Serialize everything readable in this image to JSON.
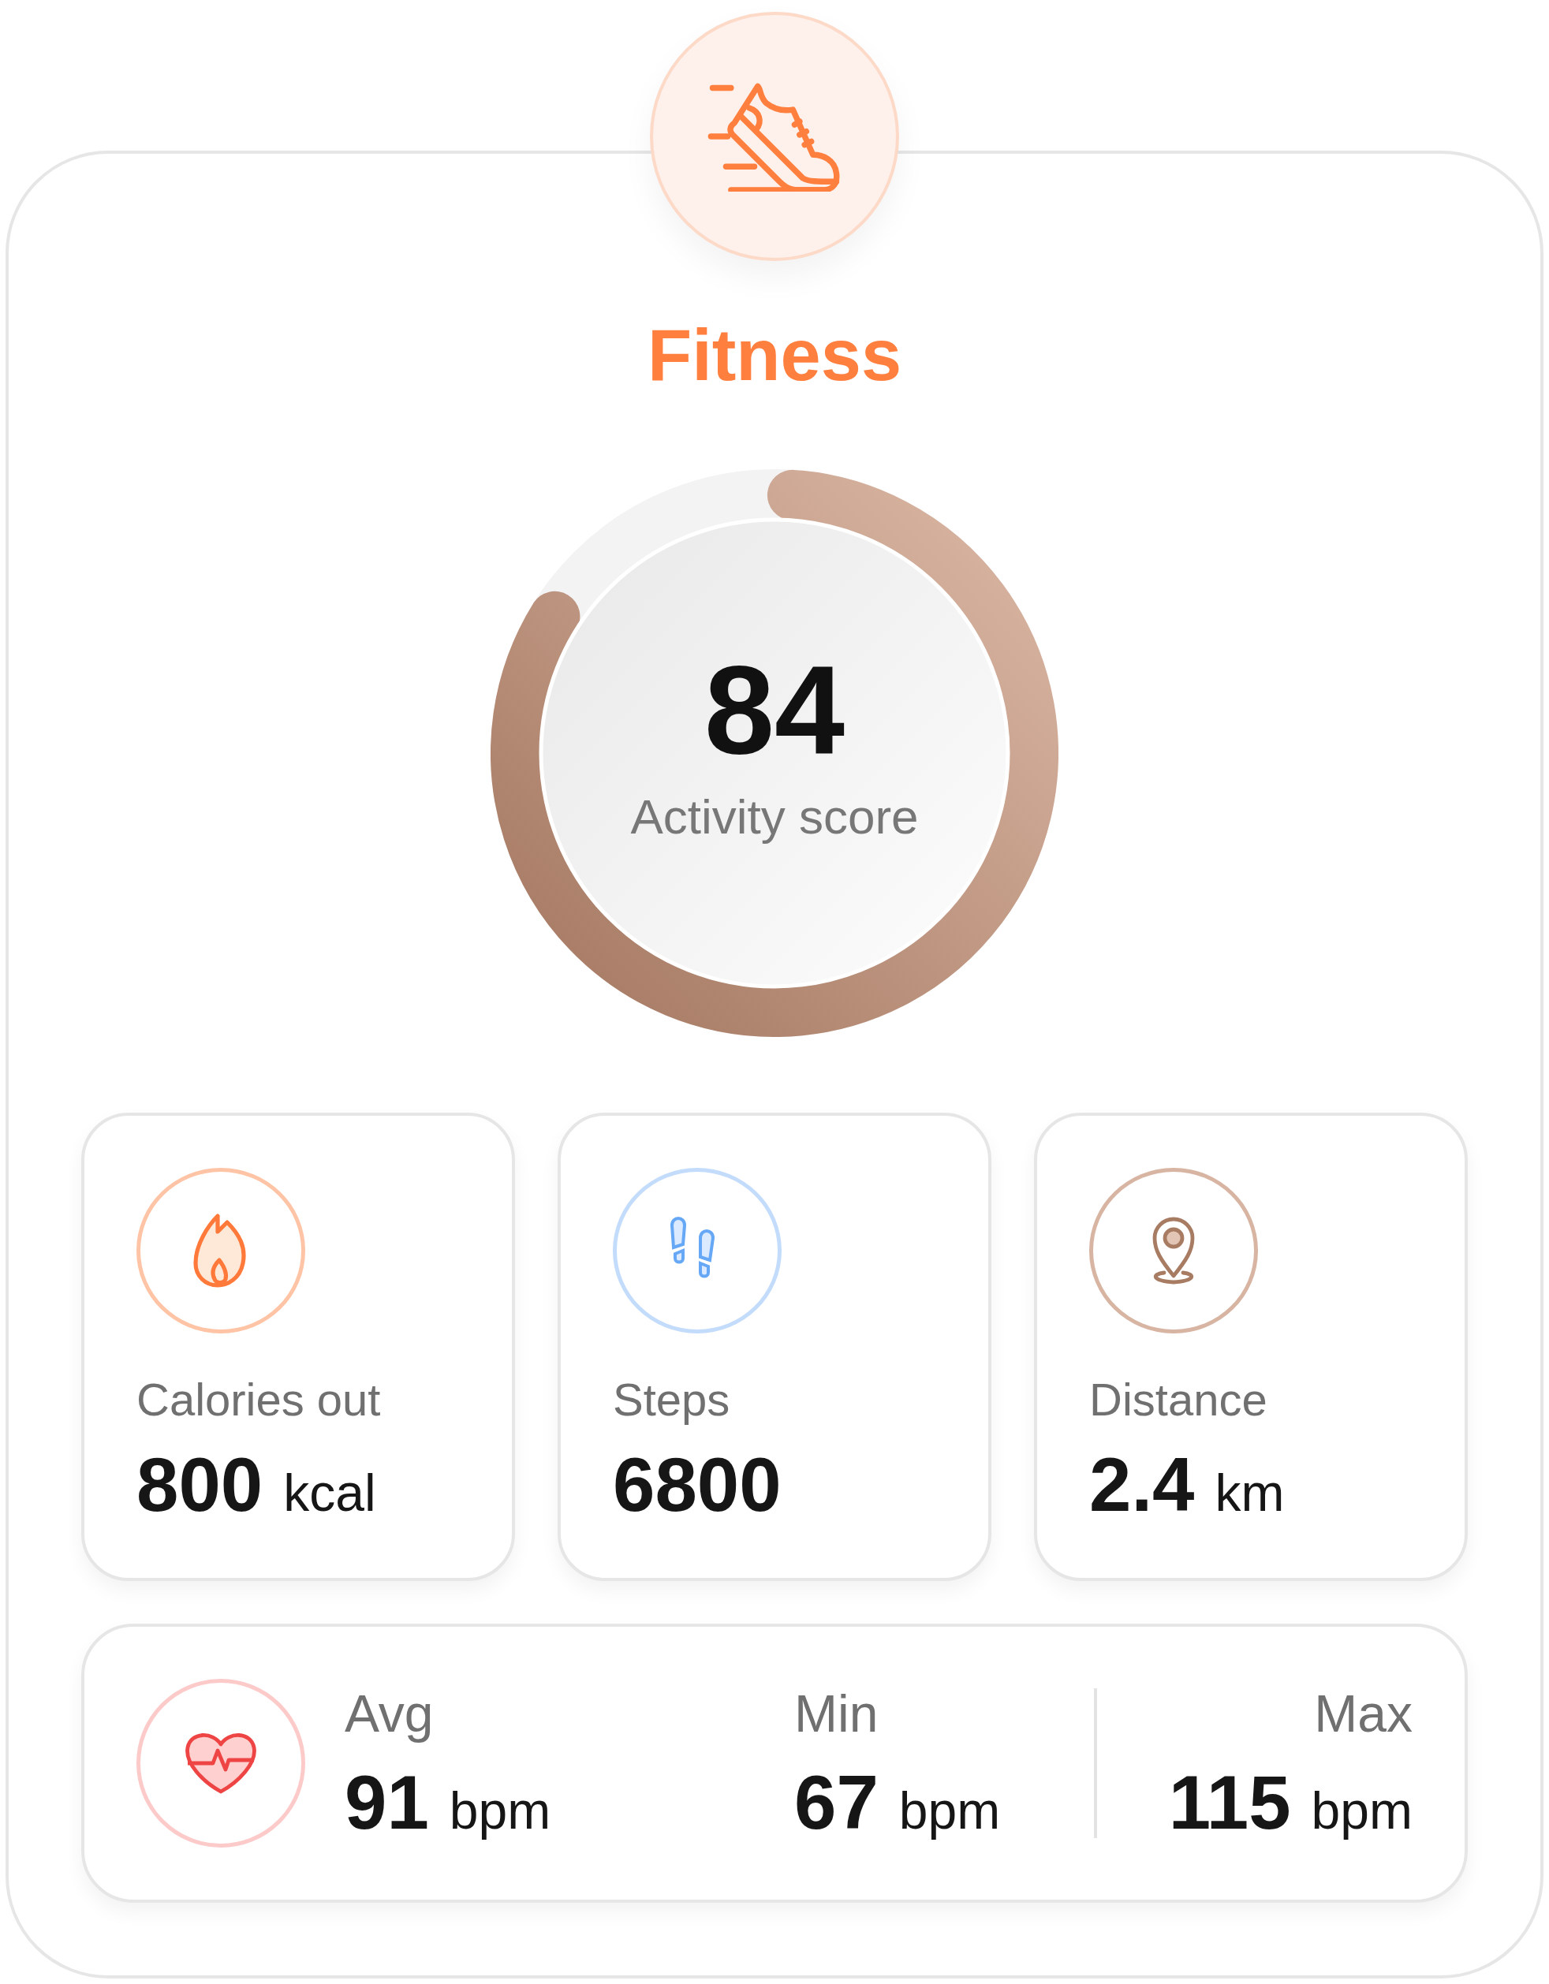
{
  "header": {
    "title": "Fitness"
  },
  "score": {
    "value": "84",
    "label": "Activity score"
  },
  "stats": [
    {
      "kind": "calories",
      "label": "Calories out",
      "value": "800",
      "unit": "kcal"
    },
    {
      "kind": "steps",
      "label": "Steps",
      "value": "6800"
    },
    {
      "kind": "distance",
      "label": "Distance",
      "value": "2.4",
      "unit": "km"
    }
  ],
  "heart_rate": [
    {
      "label": "Avg",
      "value": "91",
      "unit": "bpm"
    },
    {
      "label": "Min",
      "value": "67",
      "unit": "bpm"
    },
    {
      "label": "Max",
      "value": "115",
      "unit": "bpm"
    }
  ]
}
